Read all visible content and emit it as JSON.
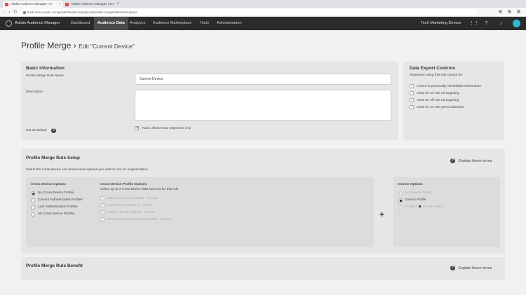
{
  "browser": {
    "tabs": [
      {
        "title": "Adobe Audience Manager | P...",
        "active": true
      },
      {
        "title": "Adobe Audience Manager | D...",
        "active": false
      }
    ],
    "url": "bank.demo.adobe.com/portal/#/audience/segments/profile-merge/edit/current-device"
  },
  "app": {
    "name": "Adobe Audience Manager",
    "nav": [
      "Dashboard",
      "Audience Data",
      "Analytics",
      "Audience Marketplace",
      "Tools",
      "Administration"
    ],
    "active_nav": "Audience Data",
    "org": "Tech Marketing Demos"
  },
  "page": {
    "title": "Profile Merge",
    "breadcrumb_sep": "›",
    "subtitle": "Edit \"Current Device\""
  },
  "basic": {
    "heading": "Basic Information",
    "name_label": "Profile Merge Rule Name",
    "name_value": "Current Device",
    "desc_label": "Description",
    "desc_value": "",
    "default_label": "Set as default",
    "default_note": "Note: affects new segments only"
  },
  "export": {
    "heading": "Data Export Controls",
    "subtext": "Segments using this rule cannot be:",
    "items": [
      "Linked to personally identifiable information",
      "Used for on-site ad targeting",
      "Used for off-site ad targeting",
      "Used for on-site personalization"
    ]
  },
  "setup": {
    "heading": "Profile Merge Rule Setup",
    "desc": "Select the cross-device and device level options you wish to use for segmentation",
    "explain": "Explain these terms",
    "cross_heading": "Cross-Device Options",
    "cross_options": [
      "No Cross-Device Profile",
      "Current Authenticated Profiles",
      "Last Authenticated Profiles",
      "All Cross-Device Profiles"
    ],
    "cdp_heading": "Cross-Device Profile Options",
    "cdp_sub": "Select up to 3 cross-device data sources for this rule",
    "cdp_items": [
      "Data Store Leads (d123) - Person",
      "Customer ID (0DB12) - Person",
      "Hashed Email Address - Person",
      "Tech Marketing Demos d2d-4038 - Person"
    ],
    "plus": "+",
    "device_heading": "Device Options",
    "device_options": [
      "No Device Profile",
      "Device Profile",
      "Profile Link Device Graph"
    ]
  },
  "benefit": {
    "heading": "Profile Merge Rule Benefit",
    "explain": "Explain these terms"
  },
  "icons": {
    "help": "help-circle-icon",
    "checkbox": "checkbox-icon",
    "radio": "radio-icon",
    "arrow": "arrow-right-icon"
  }
}
